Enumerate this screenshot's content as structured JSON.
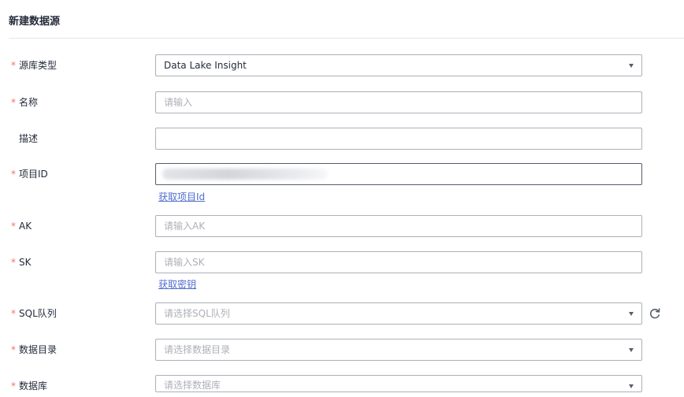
{
  "page": {
    "title": "新建数据源"
  },
  "form": {
    "source_type": {
      "label": "源库类型",
      "value": "Data Lake Insight"
    },
    "name": {
      "label": "名称",
      "placeholder": "请输入"
    },
    "description": {
      "label": "描述",
      "value": ""
    },
    "project_id": {
      "label": "项目ID",
      "link": "获取项目Id"
    },
    "ak": {
      "label": "AK",
      "placeholder": "请输入AK"
    },
    "sk": {
      "label": "SK",
      "placeholder": "请输入SK",
      "link": "获取密钥"
    },
    "sql_queue": {
      "label": "SQL队列",
      "placeholder": "请选择SQL队列"
    },
    "catalog": {
      "label": "数据目录",
      "placeholder": "请选择数据目录"
    },
    "database": {
      "label": "数据库",
      "placeholder": "请选择数据库"
    }
  },
  "required_marker": "*",
  "colors": {
    "required": "#f66f6a",
    "link": "#526ecc",
    "border": "#adb0b8"
  },
  "icons": {
    "dropdown": "chevron-down-icon",
    "refresh": "refresh-icon"
  }
}
